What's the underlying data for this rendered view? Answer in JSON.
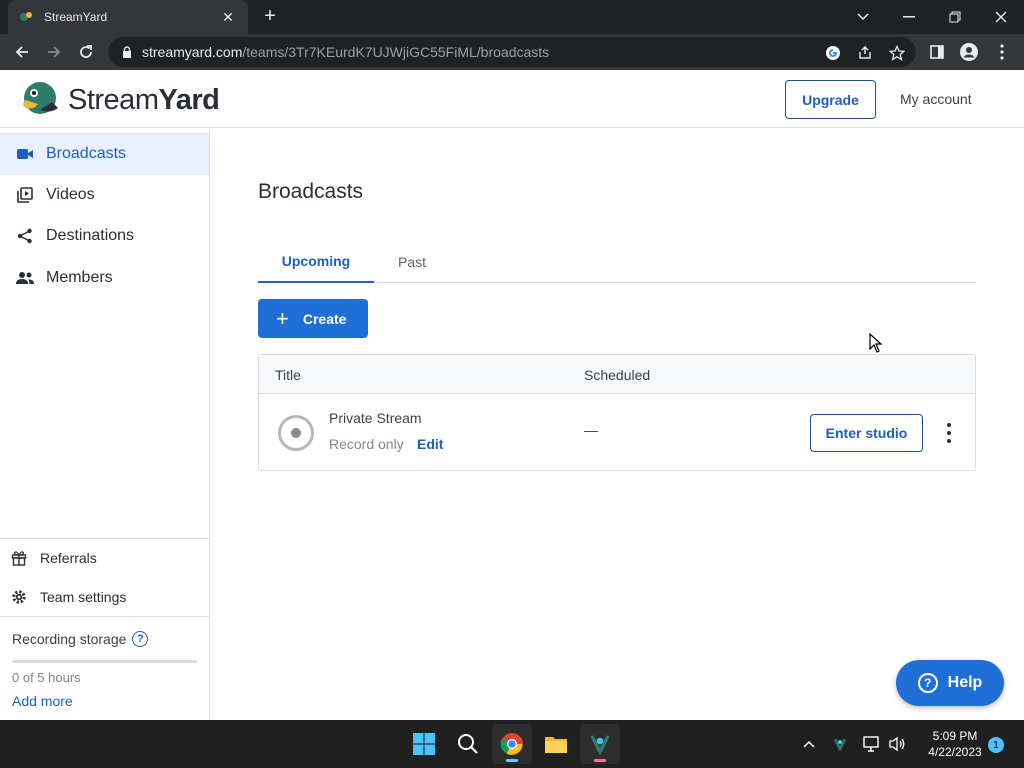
{
  "browser": {
    "tab_title": "StreamYard",
    "url_host": "streamyard.com",
    "url_path": "/teams/3Tr7KEurdK7UJWjiGC55FiML/broadcasts"
  },
  "header": {
    "logo_text_light": "Stream",
    "logo_text_bold": "Yard",
    "upgrade_label": "Upgrade",
    "account_label": "My account"
  },
  "sidebar": {
    "items": [
      {
        "label": "Broadcasts",
        "icon": "video-camera-icon"
      },
      {
        "label": "Videos",
        "icon": "video-library-icon"
      },
      {
        "label": "Destinations",
        "icon": "share-icon"
      },
      {
        "label": "Members",
        "icon": "people-icon"
      }
    ],
    "bottom_items": [
      {
        "label": "Referrals",
        "icon": "gift-icon"
      },
      {
        "label": "Team settings",
        "icon": "gear-icon"
      }
    ],
    "storage_title": "Recording storage",
    "storage_help": "?",
    "storage_used_text": "0 of 5 hours",
    "storage_fraction": 0,
    "add_more_label": "Add more"
  },
  "main": {
    "title": "Broadcasts",
    "tabs": [
      {
        "label": "Upcoming",
        "active": true
      },
      {
        "label": "Past",
        "active": false
      }
    ],
    "create_label": "Create",
    "table": {
      "columns": [
        "Title",
        "Scheduled"
      ],
      "rows": [
        {
          "title": "Private Stream",
          "subtitle": "Record only",
          "edit_label": "Edit",
          "scheduled": "—",
          "action_label": "Enter studio"
        }
      ]
    }
  },
  "help_label": "Help",
  "taskbar": {
    "time": "5:09 PM",
    "date": "4/22/2023",
    "notification_count": "1"
  },
  "colors": {
    "accent": "#1f6fd6",
    "link": "#1f5fbf",
    "active_nav_bg": "#e8f0fe"
  }
}
